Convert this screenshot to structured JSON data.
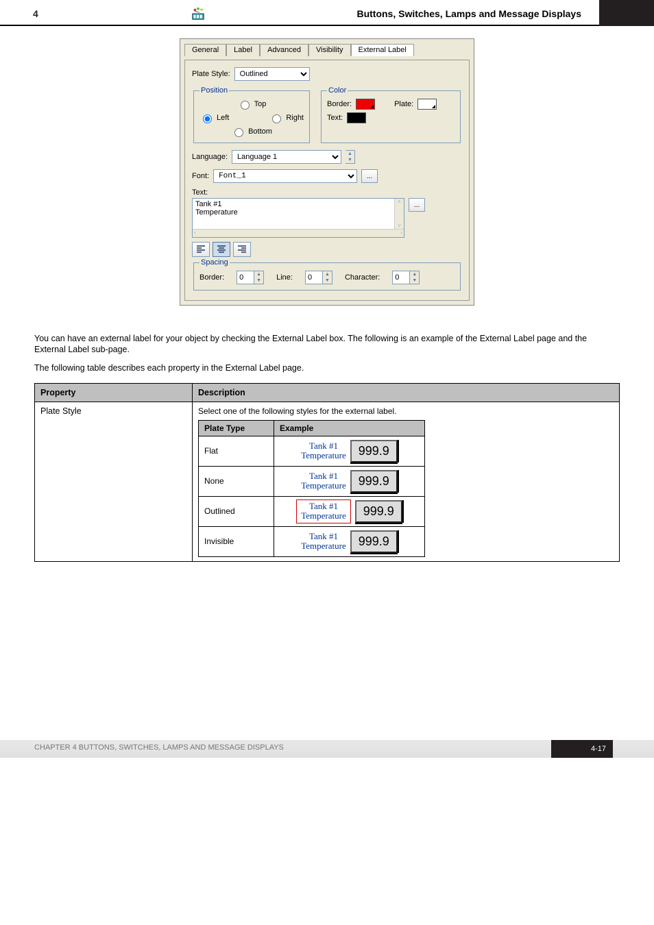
{
  "header": {
    "chapter": "4",
    "section": "Buttons, Switches, Lamps and Message Displays"
  },
  "dialog": {
    "tabs": [
      "General",
      "Label",
      "Advanced",
      "Visibility",
      "External Label"
    ],
    "active_tab": 4,
    "plate_style_label": "Plate Style:",
    "plate_style_value": "Outlined",
    "position_legend": "Position",
    "pos_top": "Top",
    "pos_left": "Left",
    "pos_right": "Right",
    "pos_bottom": "Bottom",
    "pos_selected": "Left",
    "color_legend": "Color",
    "color_border_label": "Border:",
    "color_plate_label": "Plate:",
    "color_text_label": "Text:",
    "language_label": "Language:",
    "language_value": "Language 1",
    "font_label": "Font:",
    "font_value": "Font_1",
    "text_label": "Text:",
    "text_value": "Tank #1\nTemperature",
    "spacing_legend": "Spacing",
    "spacing_border_label": "Border:",
    "spacing_border_value": "0",
    "spacing_line_label": "Line:",
    "spacing_line_value": "0",
    "spacing_char_label": "Character:",
    "spacing_char_value": "0"
  },
  "para1": "You can have an external label for your object by checking the External Label box. The following is an example of the External Label page and the External Label sub-page.",
  "para2": "The following table describes each property in the External Label page.",
  "table": {
    "col1": "Property",
    "col2": "Description",
    "row_style_prop": "Plate Style",
    "row_style_desc": "Select one of the following styles for the external label.",
    "sub_col1": "Plate Type",
    "sub_col2": "Example",
    "types": [
      "Flat",
      "None",
      "Outlined",
      "Invisible"
    ],
    "ex_label_line1": "Tank #1",
    "ex_label_line2": "Temperature",
    "ex_value": "999.9"
  },
  "footer": {
    "text": "CHAPTER 4   BUTTONS, SWITCHES, LAMPS AND MESSAGE DISPLAYS",
    "page": "4-17"
  }
}
